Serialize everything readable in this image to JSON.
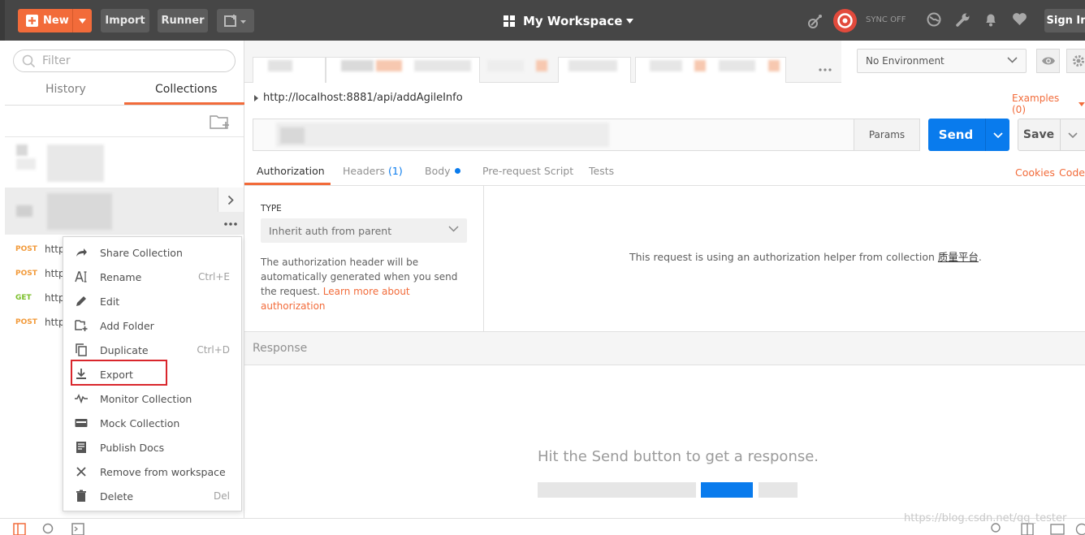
{
  "topbar": {
    "new_label": "New",
    "import_label": "Import",
    "runner_label": "Runner",
    "workspace_label": "My Workspace",
    "sync_label": "SYNC OFF",
    "signin_label": "Sign In"
  },
  "sidebar": {
    "filter_placeholder": "Filter",
    "tabs": [
      {
        "label": "History"
      },
      {
        "label": "Collections"
      }
    ],
    "requests": [
      {
        "method": "POST",
        "text": "http"
      },
      {
        "method": "POST",
        "text": "http"
      },
      {
        "method": "GET",
        "text": "http"
      },
      {
        "method": "POST",
        "text": "http"
      }
    ]
  },
  "context_menu": {
    "items": [
      {
        "label": "Share Collection",
        "shortcut": "",
        "icon": "share-icon"
      },
      {
        "label": "Rename",
        "shortcut": "Ctrl+E",
        "icon": "rename-icon"
      },
      {
        "label": "Edit",
        "shortcut": "",
        "icon": "edit-icon"
      },
      {
        "label": "Add Folder",
        "shortcut": "",
        "icon": "add-folder-icon"
      },
      {
        "label": "Duplicate",
        "shortcut": "Ctrl+D",
        "icon": "duplicate-icon"
      },
      {
        "label": "Export",
        "shortcut": "",
        "icon": "export-icon"
      },
      {
        "label": "Monitor Collection",
        "shortcut": "",
        "icon": "monitor-icon"
      },
      {
        "label": "Mock Collection",
        "shortcut": "",
        "icon": "mock-icon"
      },
      {
        "label": "Publish Docs",
        "shortcut": "",
        "icon": "publish-icon"
      },
      {
        "label": "Remove from workspace",
        "shortcut": "",
        "icon": "remove-icon"
      },
      {
        "label": "Delete",
        "shortcut": "Del",
        "icon": "delete-icon"
      }
    ]
  },
  "environment": {
    "selected": "No Environment"
  },
  "request": {
    "url": "http://localhost:8881/api/addAgileInfo",
    "examples_label": "Examples (0)",
    "params_label": "Params",
    "send_label": "Send",
    "save_label": "Save",
    "subtabs": {
      "authorization": "Authorization",
      "headers": "Headers",
      "headers_count": "(1)",
      "body": "Body",
      "prerequest": "Pre-request Script",
      "tests": "Tests"
    },
    "cookies_label": "Cookies",
    "code_label": "Code"
  },
  "auth": {
    "type_label": "TYPE",
    "type_value": "Inherit auth from parent",
    "description": "The authorization header will be automatically generated when you send the request.",
    "learn_more": "Learn more about authorization",
    "message_prefix": "This request is using an authorization helper from collection",
    "collection_name": "质量平台",
    "message_suffix": "."
  },
  "response": {
    "title": "Response",
    "hint": "Hit the Send button to get a response."
  },
  "watermark": "https://blog.csdn.net/qq_tester",
  "colors": {
    "brand_orange": "#f26b3a",
    "send_blue": "#097bed",
    "highlight_red": "#d9262c",
    "post_color": "#f29a3a",
    "get_color": "#7bbf2a"
  }
}
